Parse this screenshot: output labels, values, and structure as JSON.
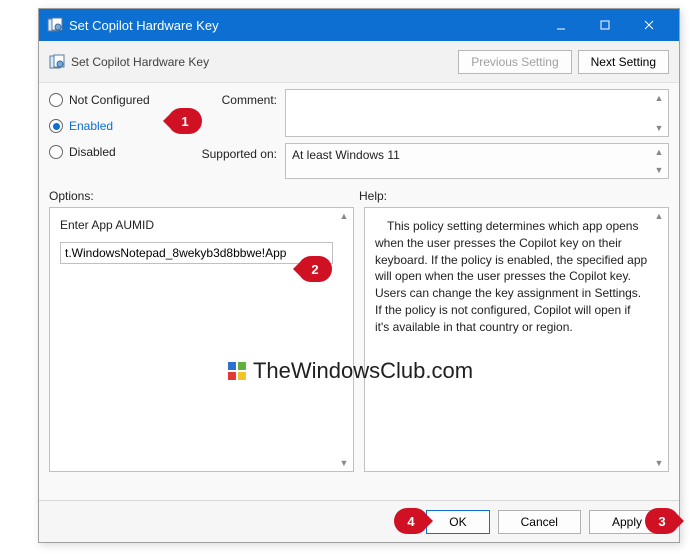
{
  "titlebar": {
    "title": "Set Copilot Hardware Key"
  },
  "toolbar": {
    "title": "Set Copilot Hardware Key",
    "prev": "Previous Setting",
    "next": "Next Setting"
  },
  "radios": {
    "not_configured": "Not Configured",
    "enabled": "Enabled",
    "disabled": "Disabled"
  },
  "fields": {
    "comment_label": "Comment:",
    "supported_label": "Supported on:",
    "supported_value": "At least Windows 11"
  },
  "labels": {
    "options": "Options:",
    "help": "Help:"
  },
  "options_panel": {
    "label": "Enter App AUMID",
    "value": "t.WindowsNotepad_8wekyb3d8bbwe!App"
  },
  "help_panel": {
    "text": "This policy setting determines which app opens when the user presses the Copilot key on their keyboard. If the policy is enabled, the specified app will open when the user presses the Copilot key. Users can change the key assignment in Settings. If the policy is not configured, Copilot will open if it's available in that country or region."
  },
  "footer": {
    "ok": "OK",
    "cancel": "Cancel",
    "apply": "Apply"
  },
  "markers": {
    "m1": "1",
    "m2": "2",
    "m3": "3",
    "m4": "4"
  },
  "watermark": {
    "text": "TheWindowsClub.com"
  }
}
